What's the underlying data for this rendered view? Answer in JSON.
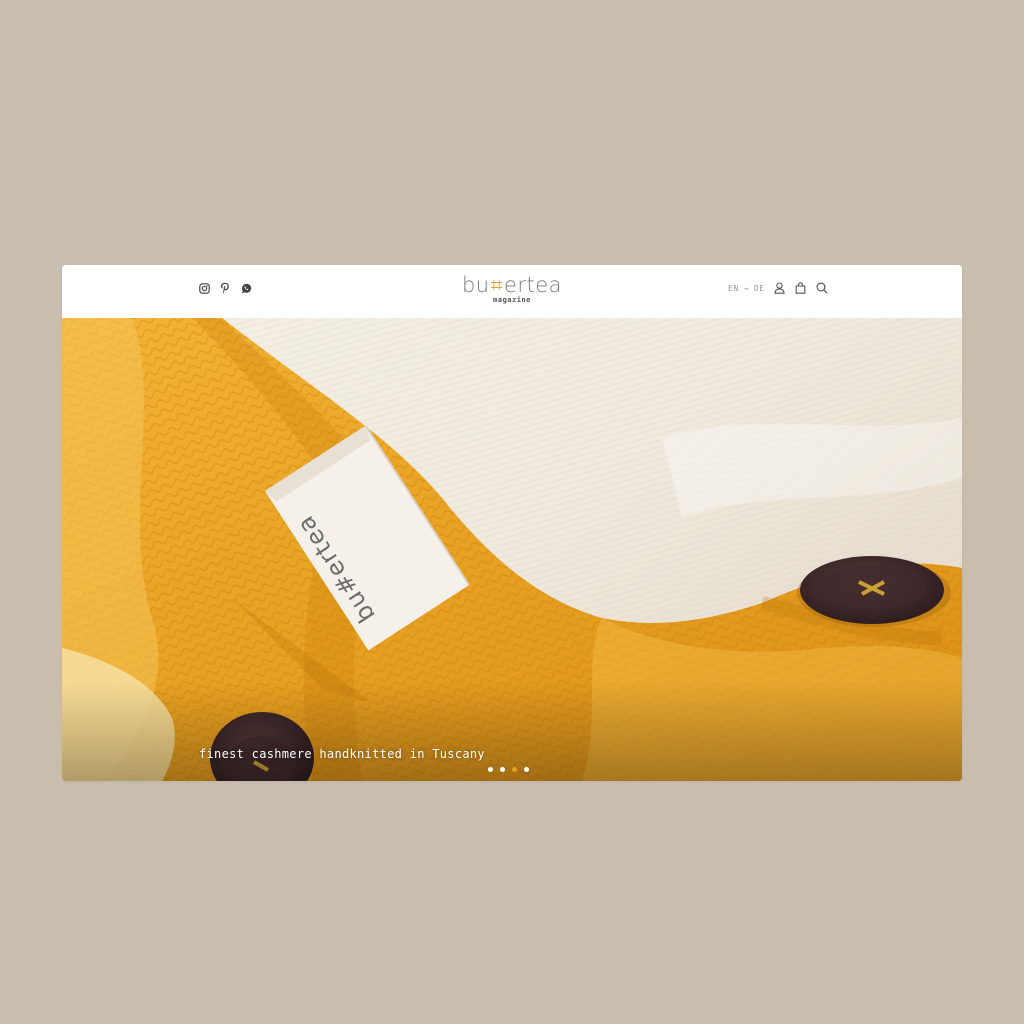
{
  "header": {
    "logo_left": "bu",
    "logo_mid": "⌗",
    "logo_right": "ertea",
    "logo_sub": "magazine",
    "lang_left": "EN",
    "lang_arrow": "→",
    "lang_right": "DE"
  },
  "social": {
    "icons": [
      "instagram-icon",
      "pinterest-icon",
      "whatsapp-icon"
    ]
  },
  "tools": {
    "icons": [
      "user-icon",
      "bag-icon",
      "search-icon"
    ]
  },
  "hero": {
    "caption": "finest cashmere handknitted in Tuscany",
    "slides_total": 4,
    "active_slide": 3
  },
  "colors": {
    "background": "#c9bdae",
    "accent": "#e3a126",
    "knit_yellow": "#e9a626",
    "knit_cream": "#f2ede3"
  }
}
